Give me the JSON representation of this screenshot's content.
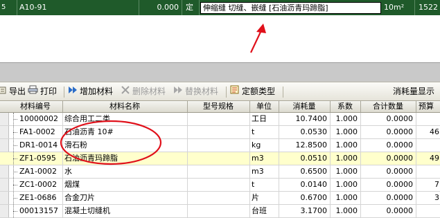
{
  "top_row": {
    "code": "A10-91",
    "value": "0.000",
    "type": "定",
    "name": "伸缩缝 切缝、嵌缝 [石油沥青玛蹄脂]",
    "unit": "10m²",
    "price": "1522"
  },
  "toolbar": {
    "export_label": "导出",
    "print_label": "打印",
    "add_material_label": "增加材料",
    "delete_material_label": "删除材料",
    "replace_material_label": "替换材料",
    "quota_type_label": "定额类型",
    "consumption_display_label": "消耗量显示"
  },
  "table": {
    "columns": {
      "code": "材料编号",
      "name": "材料名称",
      "spec": "型号规格",
      "unit": "单位",
      "consumption": "消耗量",
      "coef": "系数",
      "total": "合计数量",
      "budget": "预算"
    },
    "rows": [
      {
        "code": "10000002",
        "name": "综合用工二类",
        "spec": "",
        "unit": "工日",
        "consumption": "10.7400",
        "coef": "1.000",
        "total": "0.0000",
        "budget": ""
      },
      {
        "code": "FA1-0002",
        "name": "石油沥青 10#",
        "spec": "",
        "unit": "t",
        "consumption": "0.0530",
        "coef": "1.000",
        "total": "0.0000",
        "budget": "46"
      },
      {
        "code": "DR1-0014",
        "name": "滑石粉",
        "spec": "",
        "unit": "kg",
        "consumption": "12.8500",
        "coef": "1.000",
        "total": "0.0000",
        "budget": ""
      },
      {
        "code": "ZF1-0595",
        "name": "石油沥青玛蹄脂",
        "spec": "",
        "unit": "m3",
        "consumption": "0.0510",
        "coef": "1.000",
        "total": "0.0000",
        "budget": "49"
      },
      {
        "code": "ZA1-0002",
        "name": "水",
        "spec": "",
        "unit": "m3",
        "consumption": "0.6500",
        "coef": "1.000",
        "total": "0.0000",
        "budget": ""
      },
      {
        "code": "ZC1-0002",
        "name": "烟煤",
        "spec": "",
        "unit": "t",
        "consumption": "0.0140",
        "coef": "1.000",
        "total": "0.0000",
        "budget": "7"
      },
      {
        "code": "ZE1-0686",
        "name": "合金刀片",
        "spec": "",
        "unit": "片",
        "consumption": "0.6700",
        "coef": "1.000",
        "total": "0.0000",
        "budget": "3"
      },
      {
        "code": "00013157",
        "name": "混凝土切缝机",
        "spec": "",
        "unit": "台班",
        "consumption": "3.1700",
        "coef": "1.000",
        "total": "0.0000",
        "budget": ""
      }
    ]
  },
  "colors": {
    "selected_row_bg": "#1f5a2a",
    "highlight_row_bg": "#ffffcc",
    "annotation_red": "#e0101a"
  }
}
